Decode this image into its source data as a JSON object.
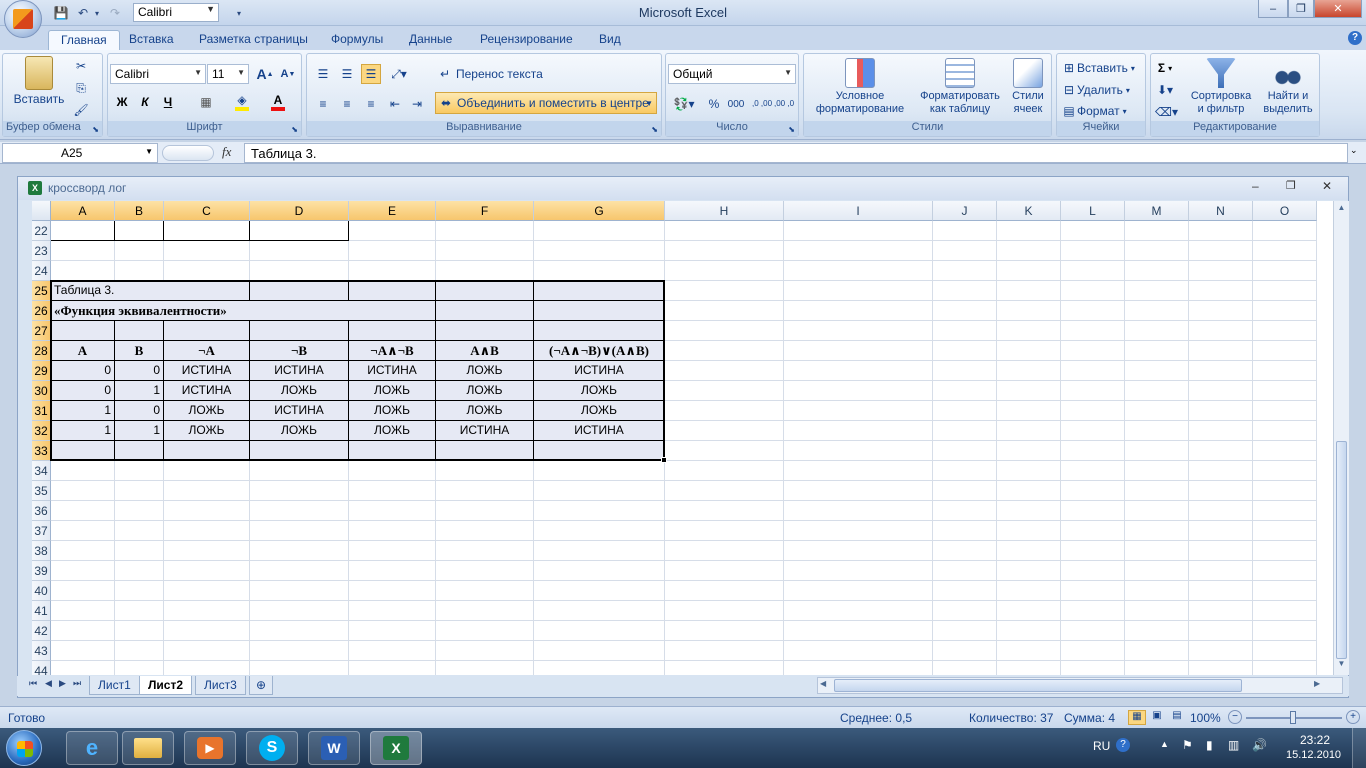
{
  "window": {
    "title": "Microsoft Excel",
    "quick_font": "Calibri",
    "minimize_label": "–",
    "restore_label": "❐",
    "close_label": "✕"
  },
  "ribbon_tabs": [
    "Главная",
    "Вставка",
    "Разметка страницы",
    "Формулы",
    "Данные",
    "Рецензирование",
    "Вид"
  ],
  "ribbon": {
    "clipboard": {
      "label": "Буфер обмена",
      "paste": "Вставить"
    },
    "font": {
      "label": "Шрифт",
      "family": "Calibri",
      "size": "11",
      "bold": "Ж",
      "italic": "К",
      "underline": "Ч",
      "grow": "A",
      "shrink": "A",
      "font_color": "A"
    },
    "alignment": {
      "label": "Выравнивание",
      "wrap_text": "Перенос текста",
      "merge_center": "Объединить и поместить в центре"
    },
    "number": {
      "label": "Число",
      "format": "Общий",
      "percent": "%",
      "thousands": "000",
      "inc_decimal": ",0 ,00",
      "dec_decimal": ",00 ,0"
    },
    "styles": {
      "label": "Стили",
      "conditional_1": "Условное",
      "conditional_2": "форматирование",
      "format_table_1": "Форматировать",
      "format_table_2": "как таблицу",
      "cell_styles_1": "Стили",
      "cell_styles_2": "ячеек"
    },
    "cells": {
      "label": "Ячейки",
      "insert": "Вставить",
      "delete": "Удалить",
      "format": "Формат"
    },
    "editing": {
      "label": "Редактирование",
      "sum": "Σ",
      "sort_1": "Сортировка",
      "sort_2": "и фильтр",
      "find_1": "Найти и",
      "find_2": "выделить"
    }
  },
  "formula_bar": {
    "name_box": "A25",
    "fx": "fx",
    "formula": "Таблица 3."
  },
  "workbook": {
    "title": "кроссворд лог"
  },
  "columns": [
    "A",
    "B",
    "C",
    "D",
    "E",
    "F",
    "G",
    "H",
    "I",
    "J",
    "K",
    "L",
    "M",
    "N",
    "O"
  ],
  "rows": [
    {
      "num": "22",
      "cells": {}
    },
    {
      "num": "23",
      "cells": {}
    },
    {
      "num": "24",
      "cells": {}
    },
    {
      "num": "25",
      "cells": {
        "A": "Таблица 3."
      }
    },
    {
      "num": "26",
      "cells": {
        "A": "«Функция эквивалентности»"
      }
    },
    {
      "num": "27",
      "cells": {}
    },
    {
      "num": "28",
      "cells": {
        "A": "A",
        "B": "B",
        "C": "¬A",
        "D": "¬B",
        "E": "¬A∧¬B",
        "F": "A∧B",
        "G": "(¬A∧¬B)∨(A∧B)"
      }
    },
    {
      "num": "29",
      "cells": {
        "A": "0",
        "B": "0",
        "C": "ИСТИНА",
        "D": "ИСТИНА",
        "E": "ИСТИНА",
        "F": "ЛОЖЬ",
        "G": "ИСТИНА"
      }
    },
    {
      "num": "30",
      "cells": {
        "A": "0",
        "B": "1",
        "C": "ИСТИНА",
        "D": "ЛОЖЬ",
        "E": "ЛОЖЬ",
        "F": "ЛОЖЬ",
        "G": "ЛОЖЬ"
      }
    },
    {
      "num": "31",
      "cells": {
        "A": "1",
        "B": "0",
        "C": "ЛОЖЬ",
        "D": "ИСТИНА",
        "E": "ЛОЖЬ",
        "F": "ЛОЖЬ",
        "G": "ЛОЖЬ"
      }
    },
    {
      "num": "32",
      "cells": {
        "A": "1",
        "B": "1",
        "C": "ЛОЖЬ",
        "D": "ЛОЖЬ",
        "E": "ЛОЖЬ",
        "F": "ИСТИНА",
        "G": "ИСТИНА"
      }
    },
    {
      "num": "33",
      "cells": {}
    },
    {
      "num": "34",
      "cells": {}
    },
    {
      "num": "35",
      "cells": {}
    },
    {
      "num": "36",
      "cells": {}
    },
    {
      "num": "37",
      "cells": {}
    },
    {
      "num": "38",
      "cells": {}
    },
    {
      "num": "39",
      "cells": {}
    },
    {
      "num": "40",
      "cells": {}
    },
    {
      "num": "41",
      "cells": {}
    },
    {
      "num": "42",
      "cells": {}
    },
    {
      "num": "43",
      "cells": {}
    },
    {
      "num": "44",
      "cells": {}
    }
  ],
  "sheet_tabs": [
    "Лист1",
    "Лист2",
    "Лист3"
  ],
  "active_sheet": "Лист2",
  "status": {
    "ready": "Готово",
    "average": "Среднее: 0,5",
    "count": "Количество: 37",
    "sum": "Сумма: 4",
    "zoom": "100%"
  },
  "taskbar": {
    "language": "RU",
    "time": "23:22",
    "date": "15.12.2010"
  }
}
